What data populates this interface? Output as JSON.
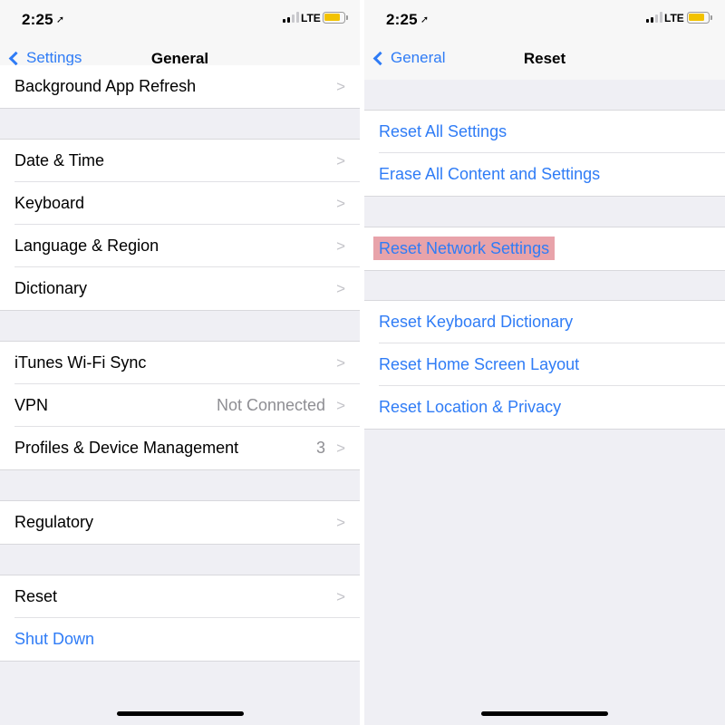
{
  "left_screen": {
    "status_bar": {
      "time": "2:25",
      "network": "LTE",
      "signal_bars": 2,
      "battery_color": "#f2c200"
    },
    "nav": {
      "back_label": "Settings",
      "title": "General"
    },
    "rows": {
      "background_app_refresh": "Background App Refresh",
      "date_time": "Date & Time",
      "keyboard": "Keyboard",
      "language_region": "Language & Region",
      "dictionary": "Dictionary",
      "itunes_wifi_sync": "iTunes Wi-Fi Sync",
      "vpn": "VPN",
      "vpn_value": "Not Connected",
      "profiles": "Profiles & Device Management",
      "profiles_value": "3",
      "regulatory": "Regulatory",
      "reset": "Reset",
      "shut_down": "Shut Down"
    }
  },
  "right_screen": {
    "status_bar": {
      "time": "2:25",
      "network": "LTE",
      "signal_bars": 2,
      "battery_color": "#f2c200"
    },
    "nav": {
      "back_label": "General",
      "title": "Reset"
    },
    "rows": {
      "reset_all_settings": "Reset All Settings",
      "erase_all": "Erase All Content and Settings",
      "reset_network": "Reset Network Settings",
      "reset_keyboard_dictionary": "Reset Keyboard Dictionary",
      "reset_home_screen_layout": "Reset Home Screen Layout",
      "reset_location_privacy": "Reset Location & Privacy"
    },
    "highlighted_row": "reset_network",
    "highlight_color": "#e8a3aa"
  },
  "colors": {
    "accent_blue": "#2f7cf6",
    "group_background": "#efeff4",
    "secondary_text": "#8e8e93"
  },
  "icons": {
    "back": "chevron-left-icon",
    "disclosure": "chevron-right-icon",
    "location": "location-arrow-icon",
    "signal": "cellular-signal-icon",
    "battery": "battery-icon"
  }
}
